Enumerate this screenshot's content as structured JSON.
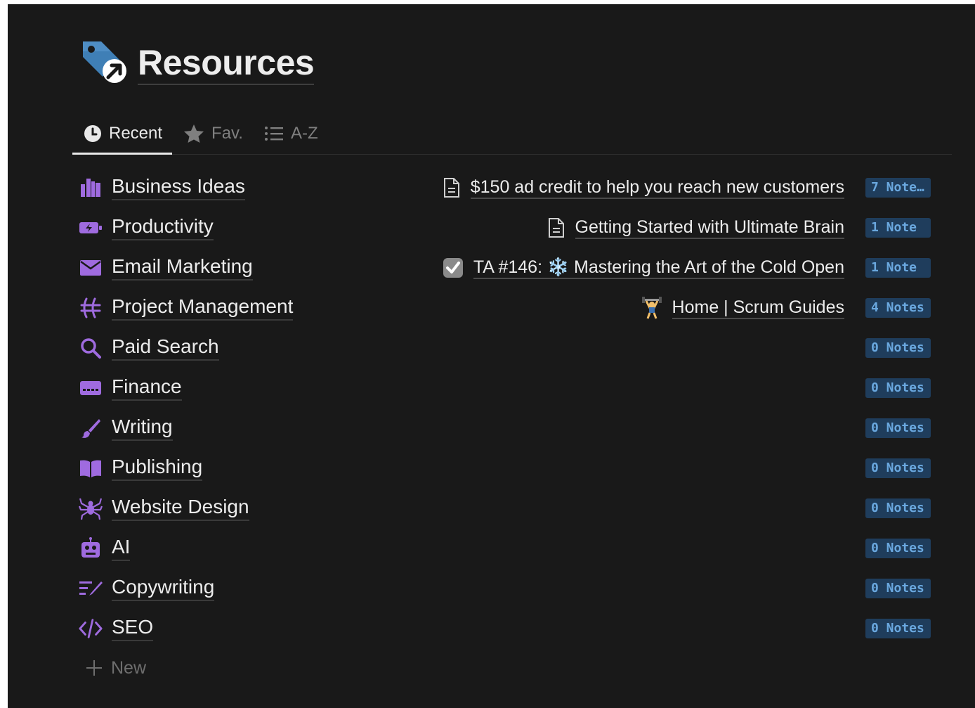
{
  "page": {
    "title": "Resources",
    "icon": "tag-with-arrow-icon"
  },
  "tabs": [
    {
      "label": "Recent",
      "icon": "clock-icon",
      "active": true
    },
    {
      "label": "Fav.",
      "icon": "star-icon",
      "active": false
    },
    {
      "label": "A-Z",
      "icon": "list-icon",
      "active": false
    }
  ],
  "categories": [
    {
      "name": "Business Ideas",
      "icon": "buildings-icon",
      "recent": "$150 ad credit to help you reach new customers",
      "recent_icon": "document-icon",
      "notes": "7 Note…"
    },
    {
      "name": "Productivity",
      "icon": "battery-bolt-icon",
      "recent": "Getting Started with Ultimate Brain",
      "recent_icon": "document-icon",
      "notes": "1 Note"
    },
    {
      "name": "Email Marketing",
      "icon": "envelope-icon",
      "recent": "TA #146: ❄️ Mastering the Art of the Cold Open",
      "recent_icon": "checkbox-icon",
      "notes": "1 Note"
    },
    {
      "name": "Project Management",
      "icon": "scrum-icon",
      "recent": "Home | Scrum Guides",
      "recent_icon": "weightlifter-icon",
      "notes": "4 Notes"
    },
    {
      "name": "Paid Search",
      "icon": "magnifier-icon",
      "recent": "",
      "notes": "0 Notes"
    },
    {
      "name": "Finance",
      "icon": "credit-card-icon",
      "recent": "",
      "notes": "0 Notes"
    },
    {
      "name": "Writing",
      "icon": "brush-icon",
      "recent": "",
      "notes": "0 Notes"
    },
    {
      "name": "Publishing",
      "icon": "open-book-icon",
      "recent": "",
      "notes": "0 Notes"
    },
    {
      "name": "Website Design",
      "icon": "spider-icon",
      "recent": "",
      "notes": "0 Notes"
    },
    {
      "name": "AI",
      "icon": "robot-icon",
      "recent": "",
      "notes": "0 Notes"
    },
    {
      "name": "Copywriting",
      "icon": "text-edit-icon",
      "recent": "",
      "notes": "0 Notes"
    },
    {
      "name": "SEO",
      "icon": "code-icon",
      "recent": "",
      "notes": "0 Notes"
    }
  ],
  "new_label": "New",
  "colors": {
    "background": "#191919",
    "accent_purple": "#9f6bdf",
    "badge_bg": "#1f3d5c",
    "badge_text": "#6aa8df"
  }
}
